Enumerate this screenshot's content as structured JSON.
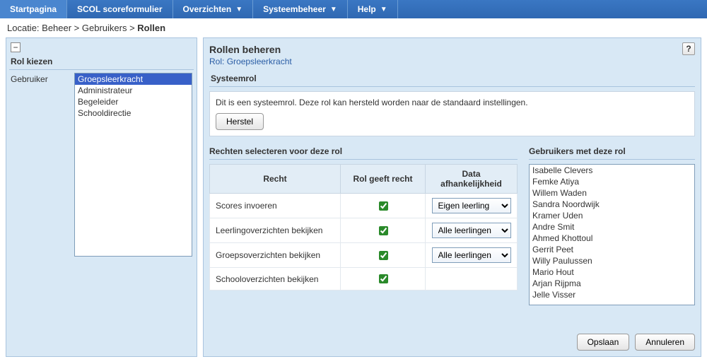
{
  "nav": {
    "items": [
      {
        "label": "Startpagina",
        "dropdown": false
      },
      {
        "label": "SCOL scoreformulier",
        "dropdown": false
      },
      {
        "label": "Overzichten",
        "dropdown": true
      },
      {
        "label": "Systeembeheer",
        "dropdown": true
      },
      {
        "label": "Help",
        "dropdown": true
      }
    ]
  },
  "breadcrumb": {
    "prefix": "Locatie: ",
    "parts": [
      "Beheer",
      "Gebruikers"
    ],
    "current": "Rollen"
  },
  "sidebar": {
    "heading": "Rol kiezen",
    "field_label": "Gebruiker",
    "roles": [
      "Groepsleerkracht",
      "Administrateur",
      "Begeleider",
      "Schooldirectie"
    ],
    "selected_index": 0
  },
  "main": {
    "title": "Rollen beheren",
    "subtitle_prefix": "Rol: ",
    "subtitle_role": "Groepsleerkracht",
    "help_glyph": "?",
    "sys_section": "Systeemrol",
    "sys_note": "Dit is een systeemrol. Deze rol kan hersteld worden naar de standaard instellingen.",
    "reset_btn": "Herstel",
    "rights_heading": "Rechten selecteren voor deze rol",
    "users_heading": "Gebruikers met deze rol",
    "table": {
      "col_right": "Recht",
      "col_grants": "Rol geeft recht",
      "col_dep": "Data afhankelijkheid",
      "rows": [
        {
          "label": "Scores invoeren",
          "checked": true,
          "dep": "Eigen leerling"
        },
        {
          "label": "Leerlingoverzichten bekijken",
          "checked": true,
          "dep": "Alle leerlingen"
        },
        {
          "label": "Groepsoverzichten bekijken",
          "checked": true,
          "dep": "Alle leerlingen"
        },
        {
          "label": "Schooloverzichten bekijken",
          "checked": true,
          "dep": ""
        }
      ]
    },
    "dep_options": [
      "Eigen leerling",
      "Alle leerlingen"
    ],
    "users": [
      "Isabelle Clevers",
      "Femke Atiya",
      "Willem Waden",
      "Sandra Noordwijk",
      "Kramer Uden",
      "Andre Smit",
      "Ahmed Khottoul",
      "Gerrit Peet",
      "Willy Paulussen",
      "Mario Hout",
      "Arjan Rijpma",
      "Jelle Visser"
    ],
    "save_btn": "Opslaan",
    "cancel_btn": "Annuleren"
  }
}
